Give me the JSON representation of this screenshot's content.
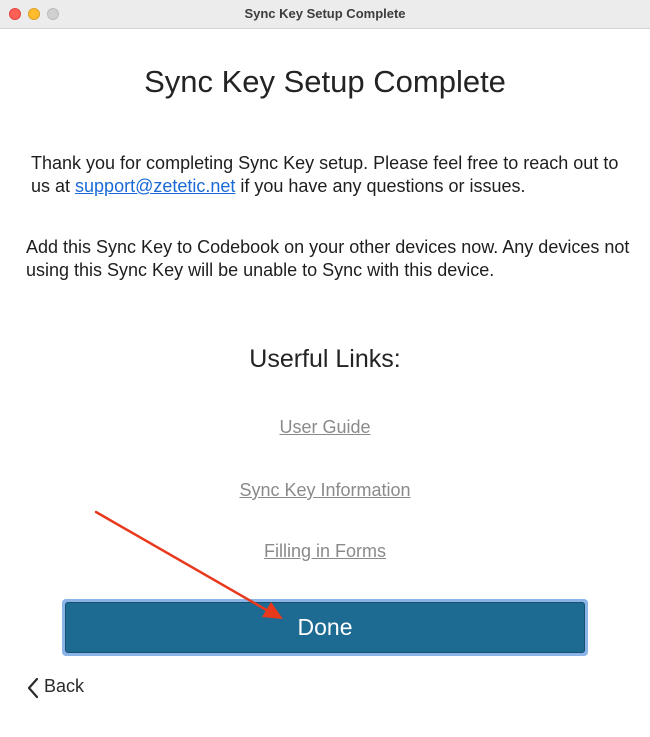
{
  "window": {
    "title": "Sync Key Setup Complete"
  },
  "page": {
    "heading": "Sync Key Setup Complete",
    "thanks_text_before": "Thank you for completing Sync Key setup.  Please feel free to reach out to us at ",
    "support_email": "support@zetetic.net",
    "thanks_text_after": " if you have any questions or issues.",
    "add_key_text": "Add this Sync Key to Codebook on your other devices now.  Any devices not using this Sync Key will be unable to Sync with this device.",
    "links_heading": "Userful Links:",
    "links": {
      "user_guide": "User Guide",
      "sync_key_info": "Sync Key Information",
      "filling_forms": "Filling in Forms"
    }
  },
  "actions": {
    "done_label": "Done",
    "back_label": "Back"
  },
  "colors": {
    "primary_button": "#1d6a93",
    "focus_ring": "#8bb4e8",
    "link_blue": "#1a6ad6",
    "annotation_arrow": "#e8391d"
  }
}
